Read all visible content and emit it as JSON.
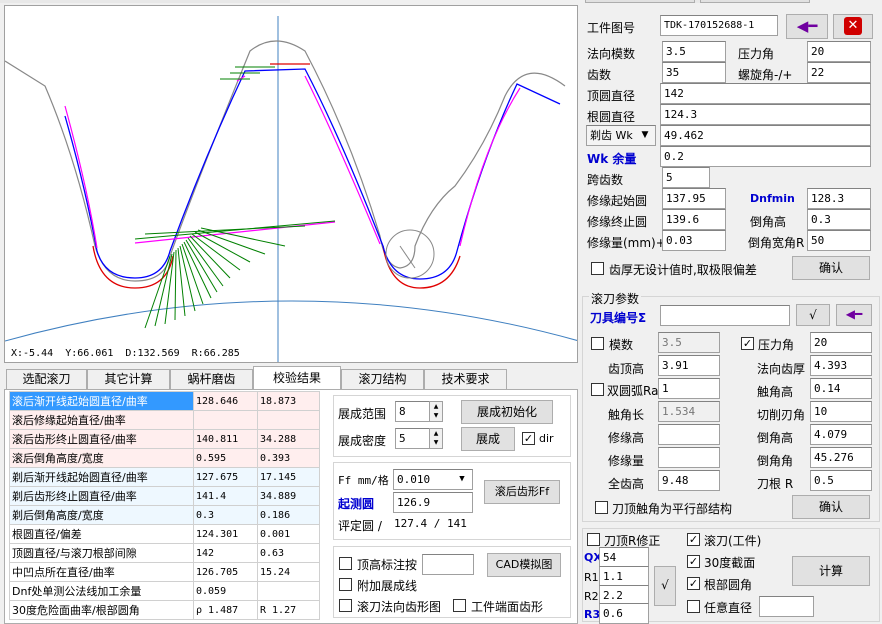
{
  "colors": {
    "gear": "#808080",
    "red": "#e00000",
    "blue": "#0000ff",
    "magenta": "#ff00ff",
    "green": "#008000",
    "axis": "#4080c0",
    "selected": "#3399ff"
  },
  "status": {
    "x": "X:-5.44",
    "y": "Y:66.061",
    "d": "D:132.569",
    "r": "R:66.285"
  },
  "tabs": [
    "选配滚刀",
    "其它计算",
    "蜗杆磨齿",
    "校验结果",
    "滚刀结构",
    "技术要求"
  ],
  "results": [
    {
      "label": "滚后渐开线起始圆直径/曲率",
      "v1": "128.646",
      "v2": "18.873",
      "bg": "#ffeeee"
    },
    {
      "label": "滚后修缘起始直径/曲率",
      "v1": "",
      "v2": "",
      "bg": "#ffeeee"
    },
    {
      "label": "滚后齿形终止圆直径/曲率",
      "v1": "140.811",
      "v2": "34.288",
      "bg": "#ffeeee"
    },
    {
      "label": "滚后倒角高度/宽度",
      "v1": "0.595",
      "v2": "0.393",
      "bg": "#ffeeee"
    },
    {
      "label": "剃后渐开线起始圆直径/曲率",
      "v1": "127.675",
      "v2": "17.145",
      "bg": "#eef8ff"
    },
    {
      "label": "剃后齿形终止圆直径/曲率",
      "v1": "141.4",
      "v2": "34.889",
      "bg": "#eef8ff"
    },
    {
      "label": "剃后倒角高度/宽度",
      "v1": "0.3",
      "v2": "0.186",
      "bg": "#eef8ff"
    },
    {
      "label": "根圆直径/偏差",
      "v1": "124.301",
      "v2": "0.001",
      "bg": "#ffffff"
    },
    {
      "label": "顶圆直径/与滚刀根部间隙",
      "v1": "142",
      "v2": "0.63",
      "bg": "#ffffff"
    },
    {
      "label": "中凹点所在直径/曲率",
      "v1": "126.705",
      "v2": "15.24",
      "bg": "#ffffff"
    },
    {
      "label": "Dnf处单测公法线加工余量",
      "v1": "0.059",
      "v2": "",
      "bg": "#ffffff"
    },
    {
      "label": "30度危险面曲率/根部圆角",
      "v1": "ρ 1.487",
      "v2": "R 1.27",
      "bg": "#ffffff"
    }
  ],
  "mid": {
    "range_label": "展成范围",
    "range": "8",
    "density_label": "展成密度",
    "density": "5",
    "init_btn": "展成初始化",
    "gen_btn": "展成",
    "dir_label": "dir",
    "ff_label": "Ff mm/格",
    "ff_value": "0.010",
    "start_circle_label": "起测圆",
    "start_circle": "126.9",
    "eval_label": "评定圆 /",
    "eval_value": "127.4 / 141",
    "ff_btn": "滚后齿形Ff",
    "top_mark": "顶高标注按",
    "extra": "附加展成线",
    "hob_normal": "滚刀法向齿形图",
    "work_face": "工件端面齿形",
    "cad_btn": "CAD模拟图"
  },
  "part": {
    "drawing_no_label": "工件图号",
    "drawing_no": "TDK-170152688-1",
    "module_label": "法向模数",
    "module": "3.5",
    "pressure_label": "压力角",
    "pressure": "20",
    "teeth_label": "齿数",
    "teeth": "35",
    "helix_label": "螺旋角-/+",
    "helix": "22",
    "tip_label": "顶圆直径",
    "tip": "142",
    "root_label": "根圆直径",
    "root": "124.3",
    "wk_select": "剃齿 Wk",
    "wk": "49.462",
    "allow_label": "Wk 余量",
    "allow": "0.2",
    "span_label": "跨齿数",
    "span": "5",
    "mod_start_label": "修缘起始圆",
    "mod_start": "137.95",
    "dnfmin_label": "Dnfmin",
    "dnfmin": "128.3",
    "mod_end_label": "修缘终止圆",
    "mod_end": "139.6",
    "chamfer_h_label": "倒角高",
    "chamfer_h": "0.3",
    "mod_amt_label": "修缘量(mm)+",
    "mod_amt": "0.03",
    "chamfer_w_label": "倒角宽角R",
    "chamfer_w": "50",
    "nodesign_label": "齿厚无设计值时,取极限偏差",
    "confirm": "确认"
  },
  "hob": {
    "section": "滚刀参数",
    "tool_no_label": "刀具编号Σ",
    "tool_no": "",
    "module_label": "模数",
    "module": "3.5",
    "pressure_label": "压力角",
    "pressure": "20",
    "addendum_label": "齿顶高",
    "addendum": "3.91",
    "normal_thk_label": "法向齿厚",
    "normal_thk": "4.393",
    "double_arc_label": "双圆弧Ra",
    "double_arc": "1",
    "prot_h_label": "触角高",
    "prot_h": "0.14",
    "prot_len_label": "触角长",
    "prot_len": "1.534",
    "cut_angle_label": "切削刃角",
    "cut_angle": "10",
    "mod_h_label": "修缘高",
    "mod_h": "",
    "chamfer_h_label": "倒角高",
    "chamfer_h": "4.079",
    "mod_amt_label": "修缘量",
    "mod_amt": "",
    "chamfer_ang_label": "倒角角",
    "chamfer_ang": "45.276",
    "full_h_label": "全齿高",
    "full_h": "9.48",
    "root_r_label": "刀根 R",
    "root_r": "0.5",
    "parallel_label": "刀顶触角为平行部结构",
    "confirm": "确认"
  },
  "bottom": {
    "tip_r_label": "刀顶R修正",
    "hob_work_label": "滚刀(工件)",
    "sec30_label": "30度截面",
    "root_fillet_label": "根部圆角",
    "any_dia_label": "任意直径",
    "qx_label": "QX",
    "qx": "54",
    "r1_label": "R1",
    "r1": "1.1",
    "r2_label": "R2",
    "r2": "2.2",
    "r3_label": "R3",
    "r3": "0.6",
    "calc_btn": "计算"
  }
}
